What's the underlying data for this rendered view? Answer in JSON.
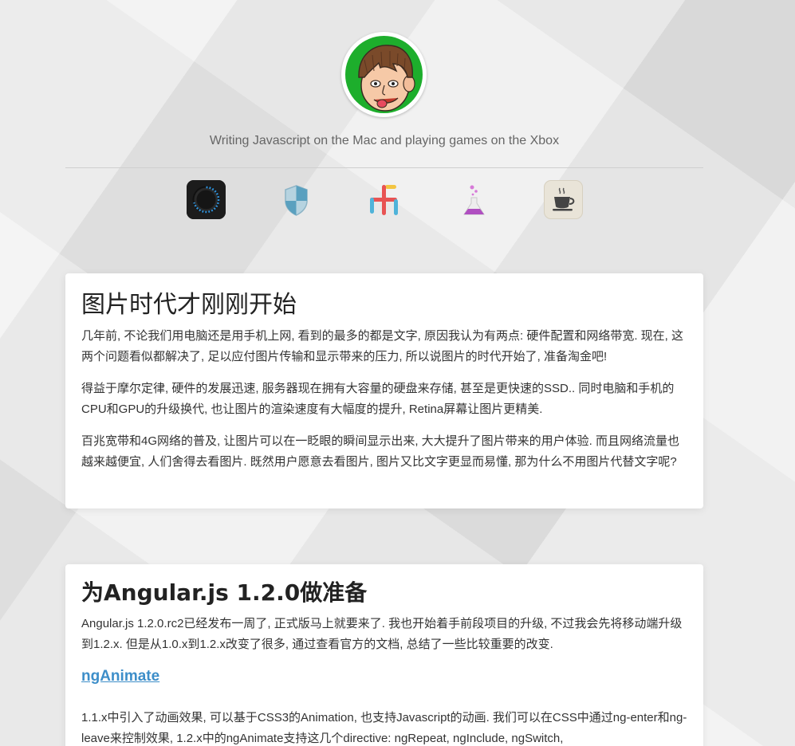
{
  "header": {
    "tagline": "Writing Javascript on the Mac and playing games on the Xbox",
    "avatar_alt": "avatar",
    "apps": [
      {
        "name": "dial-app-icon"
      },
      {
        "name": "shield-app-icon"
      },
      {
        "name": "blocks-app-icon"
      },
      {
        "name": "flask-app-icon"
      },
      {
        "name": "coffee-app-icon"
      }
    ]
  },
  "posts": [
    {
      "title": "图片时代才刚刚开始",
      "paragraphs": [
        "几年前, 不论我们用电脑还是用手机上网, 看到的最多的都是文字, 原因我认为有两点: 硬件配置和网络带宽. 现在, 这两个问题看似都解决了, 足以应付图片传输和显示带来的压力, 所以说图片的时代开始了, 准备淘金吧!",
        "得益于摩尔定律, 硬件的发展迅速, 服务器现在拥有大容量的硬盘来存储, 甚至是更快速的SSD.. 同时电脑和手机的CPU和GPU的升级换代, 也让图片的渲染速度有大幅度的提升, Retina屏幕让图片更精美.",
        "百兆宽带和4G网络的普及, 让图片可以在一眨眼的瞬间显示出来, 大大提升了图片带来的用户体验. 而且网络流量也越来越便宜, 人们舍得去看图片. 既然用户愿意去看图片, 图片又比文字更显而易懂, 那为什么不用图片代替文字呢?"
      ]
    },
    {
      "title": "为Angular.js 1.2.0做准备",
      "intro": "Angular.js 1.2.0.rc2已经发布一周了, 正式版马上就要来了. 我也开始着手前段项目的升级, 不过我会先将移动端升级到1.2.x. 但是从1.0.x到1.2.x改变了很多, 通过查看官方的文档, 总结了一些比较重要的改变.",
      "section_title": "ngAnimate",
      "section_text": "1.1.x中引入了动画效果, 可以基于CSS3的Animation, 也支持Javascript的动画. 我们可以在CSS中通过ng-enter和ng-leave来控制效果, 1.2.x中的ngAnimate支持这几个directive: ngRepeat, ngInclude, ngSwitch,"
    }
  ],
  "colors": {
    "avatar_bg": "#1dae2c",
    "link": "#3d8ec9",
    "card": "#ffffff"
  }
}
